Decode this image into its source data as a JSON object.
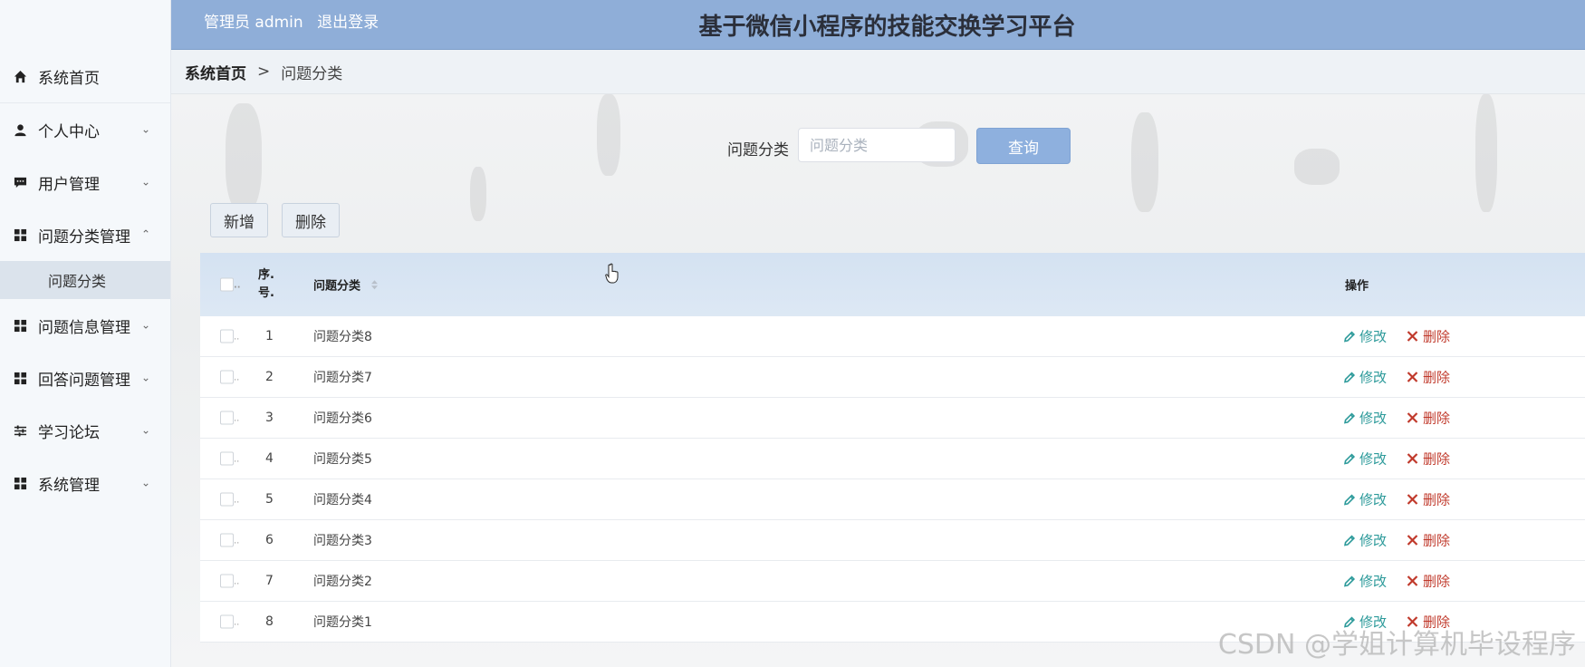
{
  "header": {
    "user_label": "管理员 admin",
    "logout_label": "退出登录",
    "title": "基于微信小程序的技能交换学习平台"
  },
  "sidebar": {
    "items": [
      {
        "label": "系统首页",
        "icon": "home-icon"
      },
      {
        "label": "个人中心",
        "icon": "user-icon",
        "arrow": "chevron-down"
      },
      {
        "label": "用户管理",
        "icon": "chat-icon",
        "arrow": "chevron-down"
      },
      {
        "label": "问题分类管理",
        "icon": "grid-icon",
        "arrow": "chevron-up"
      },
      {
        "label": "问题信息管理",
        "icon": "grid-icon",
        "arrow": "chevron-down"
      },
      {
        "label": "回答问题管理",
        "icon": "grid-icon",
        "arrow": "chevron-down"
      },
      {
        "label": "学习论坛",
        "icon": "sliders-icon",
        "arrow": "chevron-down"
      },
      {
        "label": "系统管理",
        "icon": "grid-icon",
        "arrow": "chevron-down"
      }
    ],
    "submenu": {
      "label": "问题分类"
    }
  },
  "breadcrumb": {
    "home": "系统首页",
    "separator": ">",
    "current": "问题分类"
  },
  "search": {
    "label": "问题分类",
    "placeholder": "问题分类",
    "value": "",
    "button": "查询"
  },
  "actions": {
    "add": "新增",
    "delete": "删除"
  },
  "table": {
    "headers": {
      "index_line1": "序.",
      "index_line2": "号.",
      "name": "问题分类",
      "ops": "操作"
    },
    "rows": [
      {
        "index": "1",
        "name": "问题分类8",
        "edit": "修改",
        "delete": "删除"
      },
      {
        "index": "2",
        "name": "问题分类7",
        "edit": "修改",
        "delete": "删除"
      },
      {
        "index": "3",
        "name": "问题分类6",
        "edit": "修改",
        "delete": "删除"
      },
      {
        "index": "4",
        "name": "问题分类5",
        "edit": "修改",
        "delete": "删除"
      },
      {
        "index": "5",
        "name": "问题分类4",
        "edit": "修改",
        "delete": "删除"
      },
      {
        "index": "6",
        "name": "问题分类3",
        "edit": "修改",
        "delete": "删除"
      },
      {
        "index": "7",
        "name": "问题分类2",
        "edit": "修改",
        "delete": "删除"
      },
      {
        "index": "8",
        "name": "问题分类1",
        "edit": "修改",
        "delete": "删除"
      }
    ]
  },
  "watermark": "CSDN @学姐计算机毕设程序",
  "colors": {
    "header_bg": "#8faed8",
    "edit": "#2c9a9a",
    "delete": "#c0392b",
    "query_button": "#8eb0de"
  }
}
